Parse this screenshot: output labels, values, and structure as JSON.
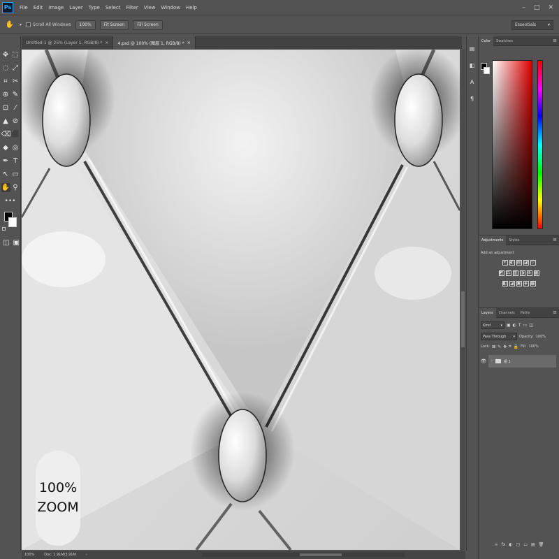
{
  "app": {
    "logo": "Ps",
    "menu": [
      "File",
      "Edit",
      "Image",
      "Layer",
      "Type",
      "Select",
      "Filter",
      "View",
      "Window",
      "Help"
    ],
    "window_controls": [
      "–",
      "□",
      "✕"
    ]
  },
  "options_bar": {
    "tool_icon": "hand-icon",
    "scroll_all_label": "Scroll All Windows",
    "zoom_value": "100%",
    "fit_screen_label": "Fit Screen",
    "fill_screen_label": "Fill Screen",
    "workspace": "Essentials"
  },
  "tools": {
    "icons": [
      "✥",
      "⬚",
      "◌",
      "⤢",
      "⌗",
      "✂",
      "⊕",
      "✎",
      "⊡",
      "⁄",
      "▲",
      "⊘",
      "⌫",
      "⬛",
      "◆",
      "◎",
      "✒",
      "T",
      "↖",
      "▭",
      "✋",
      "⚲"
    ],
    "more": "•••",
    "fg_color": "#000000",
    "bg_color": "#ffffff"
  },
  "tabs": [
    {
      "label": "Untitled-1 @ 25% (Layer 1, RGB/8) *",
      "close": "×"
    },
    {
      "label": "4.psd @ 100% (图层 1, RGB/8) *",
      "close": "×"
    }
  ],
  "canvas": {
    "zoom_badge_line1": "100%",
    "zoom_badge_line2": "ZOOM"
  },
  "status": {
    "zoom": "100%",
    "doc": "Doc: 1.91M/3.91M",
    "arrow": "›"
  },
  "color_panel": {
    "tabs": [
      "Color",
      "Swatches"
    ],
    "fg_color": "#000000",
    "bg_color": "#ffffff",
    "hue_color": "#e00000"
  },
  "adjustments_panel": {
    "tabs": [
      "Adjustments",
      "Styles"
    ],
    "add_label": "Add an adjustment",
    "row1": [
      "☀",
      "◐",
      "▤",
      "◪",
      "▽"
    ],
    "row2": [
      "◩",
      "⚖",
      "▥",
      "◑",
      "⊕",
      "▦"
    ],
    "row3": [
      "◧",
      "◢",
      "▣",
      "◈",
      "▩"
    ]
  },
  "layers_panel": {
    "tabs": [
      "Layers",
      "Channels",
      "Paths"
    ],
    "kind_label": "Kind",
    "blend_mode": "Pass Through",
    "opacity_label": "Opacity:",
    "opacity_value": "100%",
    "lock_label": "Lock:",
    "fill_label": "Fill:",
    "fill_value": "100%",
    "layer_name": "组 1",
    "footer_icons": [
      "∞",
      "fx",
      "◐",
      "▢",
      "▭",
      "▤",
      "🗑"
    ]
  },
  "menu_glyph": "≡"
}
